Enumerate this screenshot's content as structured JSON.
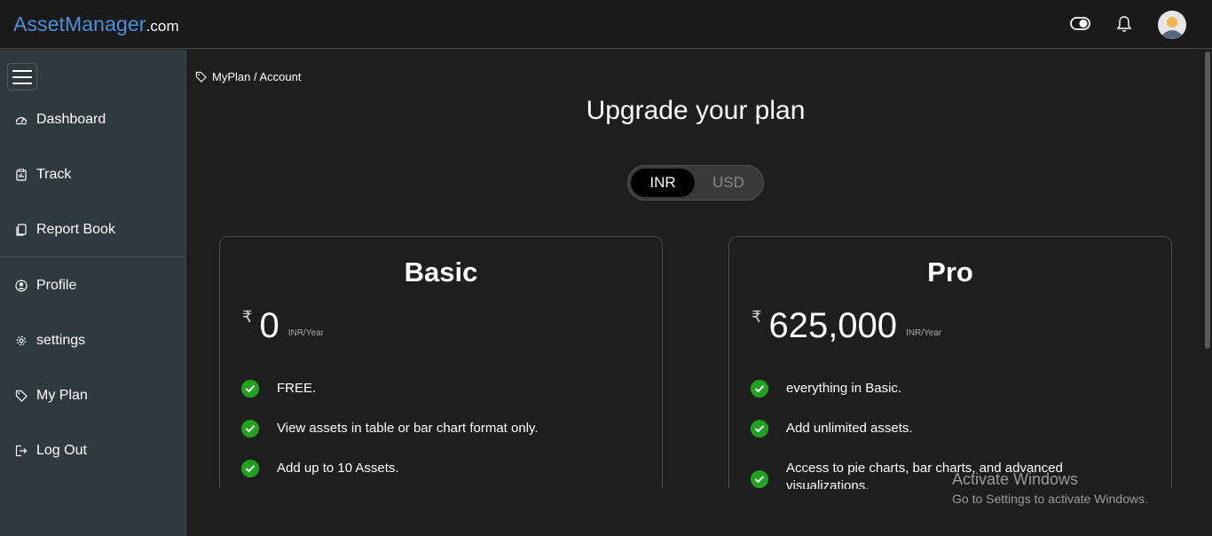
{
  "header": {
    "brand_main": "AssetManager",
    "brand_tld": ".com",
    "icons": [
      "toggle-icon",
      "bell-icon",
      "avatar"
    ]
  },
  "sidebar": {
    "items": [
      {
        "label": "Dashboard",
        "icon": "dashboard-icon"
      },
      {
        "label": "Track",
        "icon": "clipboard-icon"
      },
      {
        "label": "Report Book",
        "icon": "report-book-icon"
      },
      {
        "label": "Profile",
        "icon": "profile-icon"
      },
      {
        "label": "settings",
        "icon": "gear-icon"
      },
      {
        "label": "My Plan",
        "icon": "tag-icon"
      },
      {
        "label": "Log Out",
        "icon": "logout-icon"
      }
    ]
  },
  "breadcrumb": "MyPlan / Account",
  "page_title": "Upgrade your plan",
  "currency": {
    "options": [
      "INR",
      "USD"
    ],
    "selected": "INR"
  },
  "plans": [
    {
      "name": "Basic",
      "currency_symbol": "₹",
      "amount": "0",
      "period": "INR/Year",
      "features": [
        "FREE.",
        "View assets in table or bar chart format only.",
        "Add up to 10 Assets."
      ]
    },
    {
      "name": "Pro",
      "currency_symbol": "₹",
      "amount": "625,000",
      "period": "INR/Year",
      "features": [
        "everything in Basic.",
        "Add unlimited assets.",
        "Access to pie charts, bar charts, and advanced visualizations."
      ]
    }
  ],
  "watermark": {
    "title": "Activate Windows",
    "subtitle": "Go to Settings to activate Windows."
  },
  "colors": {
    "brand_blue": "#4a90d9",
    "check_green": "#1fa31f",
    "sidebar_bg": "#2f3a3f",
    "page_bg": "#1e1e1e"
  }
}
